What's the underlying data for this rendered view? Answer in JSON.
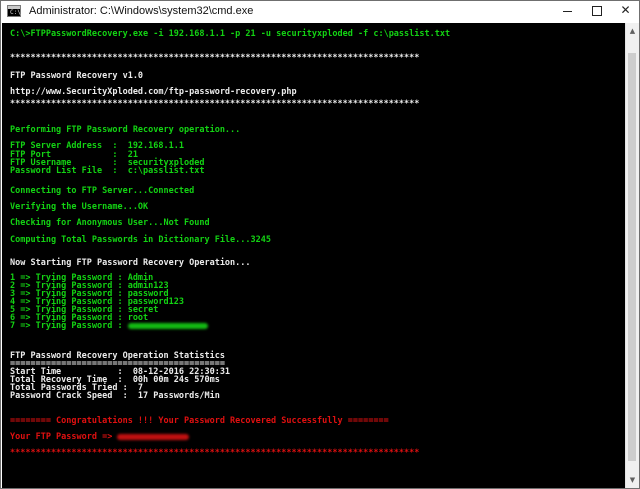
{
  "window": {
    "title": "Administrator: C:\\Windows\\system32\\cmd.exe",
    "icon": "cmd-icon",
    "icon_prompt": "C:\\",
    "buttons": {
      "minimize": "minimize-icon",
      "maximize": "maximize-icon",
      "close": "close-icon",
      "close_glyph": "✕"
    }
  },
  "console": {
    "colors": {
      "background": "#000000",
      "green": "#13d313",
      "white": "#ececec",
      "red": "#e01010"
    },
    "command": "C:\\>FTPPasswordRecovery.exe -i 192.168.1.1 -p 21 -u securityxploded -f c:\\passlist.txt",
    "separator": "********************************************************************************",
    "header_title": "FTP Password Recovery v1.0",
    "header_url": "http://www.SecurityXploded.com/ftp-password-recovery.php",
    "performing": "Performing FTP Password Recovery operation...",
    "params": {
      "server": "FTP Server Address  :  192.168.1.1",
      "port": "FTP Port            :  21",
      "username": "FTP Username        :  securityxploded",
      "passlist": "Password List File  :  c:\\passlist.txt"
    },
    "connecting": "Connecting to FTP Server...Connected",
    "verifying": "Verifying the Username...OK",
    "anonymous": "Checking for Anonymous User...Not Found",
    "computing": "Computing Total Passwords in Dictionary File...3245",
    "starting": "Now Starting FTP Password Recovery Operation...",
    "attempts": [
      "1 => Trying Password : Admin",
      "2 => Trying Password : admin123",
      "3 => Trying Password : password",
      "4 => Trying Password : password123",
      "5 => Trying Password : secret",
      "6 => Trying Password : root",
      "7 => Trying Password : "
    ],
    "stats_title": "FTP Password Recovery Operation Statistics",
    "stats_rule": "==========================================",
    "stats": {
      "start_time": "Start Time           :  08-12-2016 22:30:31",
      "recovery_time": "Total Recovery Time  :  00h 00m 24s 570ms",
      "tried": "Total Passwords Tried :  7",
      "speed": "Password Crack Speed  :  17 Passwords/Min"
    },
    "congrats": "======== Congratulations !!! Your Password Recovered Successfully ========",
    "your_password": "Your FTP Password => "
  }
}
